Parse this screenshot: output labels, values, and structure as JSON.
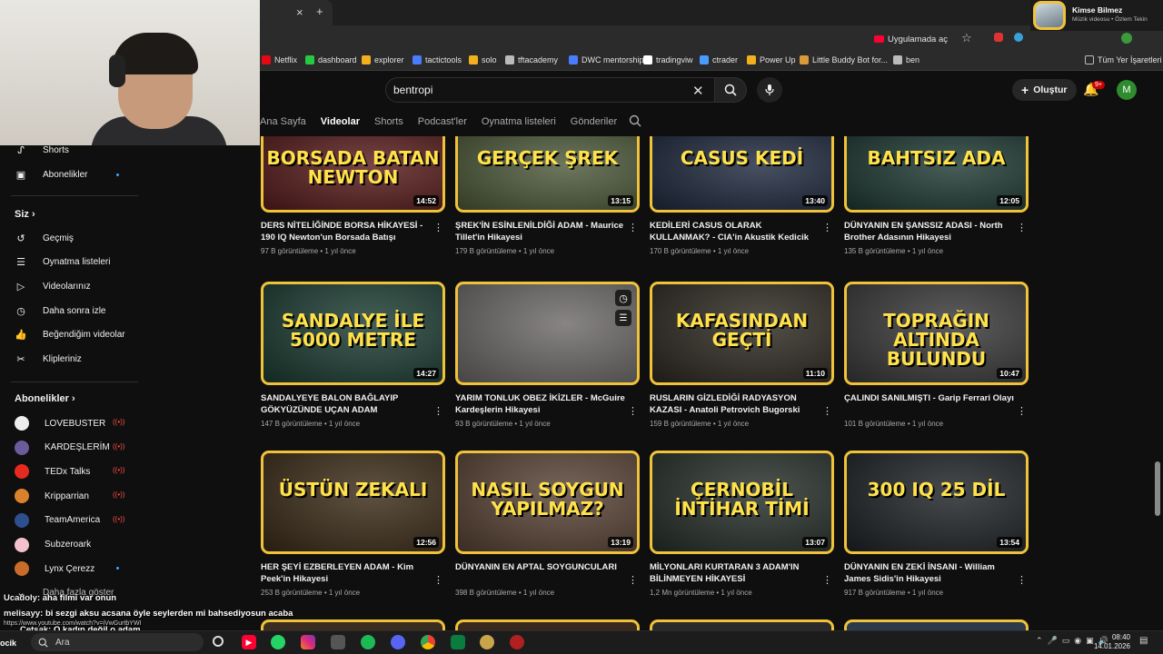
{
  "browser": {
    "tab_close": "×",
    "new_tab": "+",
    "open_in_app": "Uygulamada aç",
    "bookmarks": [
      {
        "label": "Netflix",
        "color": "#e50914"
      },
      {
        "label": "dashboard",
        "color": "#26c941"
      },
      {
        "label": "explorer",
        "color": "#f2b01e"
      },
      {
        "label": "tactictools",
        "color": "#4a7cff"
      },
      {
        "label": "solo",
        "color": "#f2b01e"
      },
      {
        "label": "tftacademy",
        "color": "#bbbbbb"
      },
      {
        "label": "DWC mentorship",
        "color": "#4a7cff"
      },
      {
        "label": "tradingviw",
        "color": "#ffffff"
      },
      {
        "label": "ctrader",
        "color": "#4a9bff"
      },
      {
        "label": "Power Up",
        "color": "#f2b01e"
      },
      {
        "label": "Little Buddy Bot for...",
        "color": "#d99a3a"
      },
      {
        "label": "ben",
        "color": "#bbbbbb"
      }
    ],
    "all_bookmarks": "Tüm Yer İşaretleri"
  },
  "music_popup": {
    "title": "Kimse Bilmez",
    "subtitle": "Müzik videosu • Özlem Tekin"
  },
  "header": {
    "search_value": "bentropi",
    "create_label": "Oluştur",
    "notification_count": "9+",
    "avatar_letter": "M"
  },
  "channel_tabs": [
    "Ana Sayfa",
    "Videolar",
    "Shorts",
    "Podcast'ler",
    "Oynatma listeleri",
    "Gönderiler"
  ],
  "sidebar": {
    "top_items": [
      {
        "label": "Shorts",
        "icon": "shorts-icon"
      },
      {
        "label": "Abonelikler",
        "icon": "subscriptions-icon"
      }
    ],
    "you_heading": "Siz",
    "you_items": [
      {
        "label": "Geçmiş",
        "icon": "history-icon"
      },
      {
        "label": "Oynatma listeleri",
        "icon": "playlists-icon"
      },
      {
        "label": "Videolarınız",
        "icon": "your-videos-icon"
      },
      {
        "label": "Daha sonra izle",
        "icon": "watch-later-icon"
      },
      {
        "label": "Beğendiğim videolar",
        "icon": "liked-icon"
      },
      {
        "label": "Klipleriniz",
        "icon": "clips-icon"
      }
    ],
    "subs_heading": "Abonelikler",
    "subscriptions": [
      {
        "label": "LOVEBUSTER",
        "color": "#eeeeee"
      },
      {
        "label": "KARDEŞLERİM",
        "color": "#6b5b9a"
      },
      {
        "label": "TEDx Talks",
        "color": "#e62b1e"
      },
      {
        "label": "Kripparrian",
        "color": "#d9822b"
      },
      {
        "label": "TeamAmerica",
        "color": "#2e4f8f"
      },
      {
        "label": "Subzeroark",
        "color": "#f4c2cc"
      },
      {
        "label": "Lynx Çerezz",
        "color": "#c96b2a"
      }
    ],
    "show_more": "Daha fazla göster"
  },
  "videos": [
    {
      "thumb_text": "BORSADA BATAN NEWTON",
      "bg": "#5a1c1c",
      "duration": "14:52",
      "title": "DERS NİTELİĞİNDE BORSA HİKAYESİ - 190 IQ Newton'un Borsada Batışı",
      "meta": "97 B görüntüleme • 1 yıl önce"
    },
    {
      "thumb_text": "GERÇEK ŞREK",
      "bg": "#4e5a3a",
      "duration": "13:15",
      "title": "ŞREK'İN ESİNLENİLDİĞİ ADAM - Maurice Tillet'in Hikayesi",
      "meta": "179 B görüntüleme • 1 yıl önce"
    },
    {
      "thumb_text": "CASUS KEDİ",
      "bg": "#1f2a3f",
      "duration": "13:40",
      "title": "KEDİLERİ CASUS OLARAK KULLANMAK? - CIA'in Akustik Kedicik Operasyonu",
      "meta": "170 B görüntüleme • 1 yıl önce"
    },
    {
      "thumb_text": "BAHTSIZ ADA",
      "bg": "#1f3a33",
      "duration": "12:05",
      "title": "DÜNYANIN EN ŞANSSIZ ADASI - North Brother Adasının Hikayesi",
      "meta": "135 B görüntüleme • 1 yıl önce"
    },
    {
      "thumb_text": "SANDALYE İLE 5000 METRE",
      "bg": "#1c3d33",
      "duration": "14:27",
      "title": "SANDALYEYE BALON BAĞLAYIP GÖKYÜZÜNDE UÇAN ADAM",
      "meta": "147 B görüntüleme • 1 yıl önce"
    },
    {
      "thumb_text": "",
      "bg": "#6d6a68",
      "duration": "",
      "title": "YARIM TONLUK OBEZ İKİZLER - McGuire Kardeşlerin Hikayesi",
      "meta": "93 B görüntüleme • 1 yıl önce"
    },
    {
      "thumb_text": "KAFASINDAN GEÇTİ",
      "bg": "#2e2a22",
      "duration": "11:10",
      "title": "RUSLARIN GİZLEDİĞİ RADYASYON KAZASI - Anatoli Petrovich Bugorski",
      "meta": "159 B görüntüleme • 1 yıl önce"
    },
    {
      "thumb_text": "TOPRAĞIN ALTINDA BULUNDU",
      "bg": "#3a3a3a",
      "duration": "10:47",
      "title": "ÇALINDI SANILMIŞTI - Garip Ferrari Olayı",
      "meta": "101 B görüntüleme • 1 yıl önce"
    },
    {
      "thumb_text": "ÜSTÜN ZEKALI",
      "bg": "#3c2c18",
      "duration": "12:56",
      "title": "HER ŞEYİ EZBERLEYEN ADAM - Kim Peek'in Hikayesi",
      "meta": "253 B görüntüleme • 1 yıl önce"
    },
    {
      "thumb_text": "NASIL SOYGUN YAPILMAZ?",
      "bg": "#5a4436",
      "duration": "13:19",
      "title": "DÜNYANIN EN APTAL SOYGUNCULARI",
      "meta": "398 B görüntüleme • 1 yıl önce"
    },
    {
      "thumb_text": "ÇERNOBİL İNTİHAR TİMİ",
      "bg": "#27302a",
      "duration": "13:07",
      "title": "MİLYONLARI KURTARAN 3 ADAM'IN BİLİNMEYEN HİKAYESİ",
      "meta": "1,2 Mn görüntüleme • 1 yıl önce"
    },
    {
      "thumb_text": "300 IQ 25 DİL",
      "bg": "#1f2327",
      "duration": "13:54",
      "title": "DÜNYANIN EN ZEKİ İNSANI - William James Sidis'in Hikayesi",
      "meta": "917 B görüntüleme • 1 yıl önce"
    }
  ],
  "chat": [
    {
      "user": "Ucadoly",
      "text": ": aha filmi var onun"
    },
    {
      "user": "melisayy",
      "text": ": bi sezgi aksu acsana öyle seylerden mi bahsediyosun acaba"
    },
    {
      "user": "",
      "text": "https://www.youtube.com/watch?v=iVwGurtbYWI"
    },
    {
      "user": "Cetsak",
      "text": ": O kadın değil o adam"
    }
  ],
  "taskbar": {
    "search_placeholder": "Ara",
    "time": "08:40",
    "date": "14.01.2026",
    "left_label": "ocik"
  }
}
